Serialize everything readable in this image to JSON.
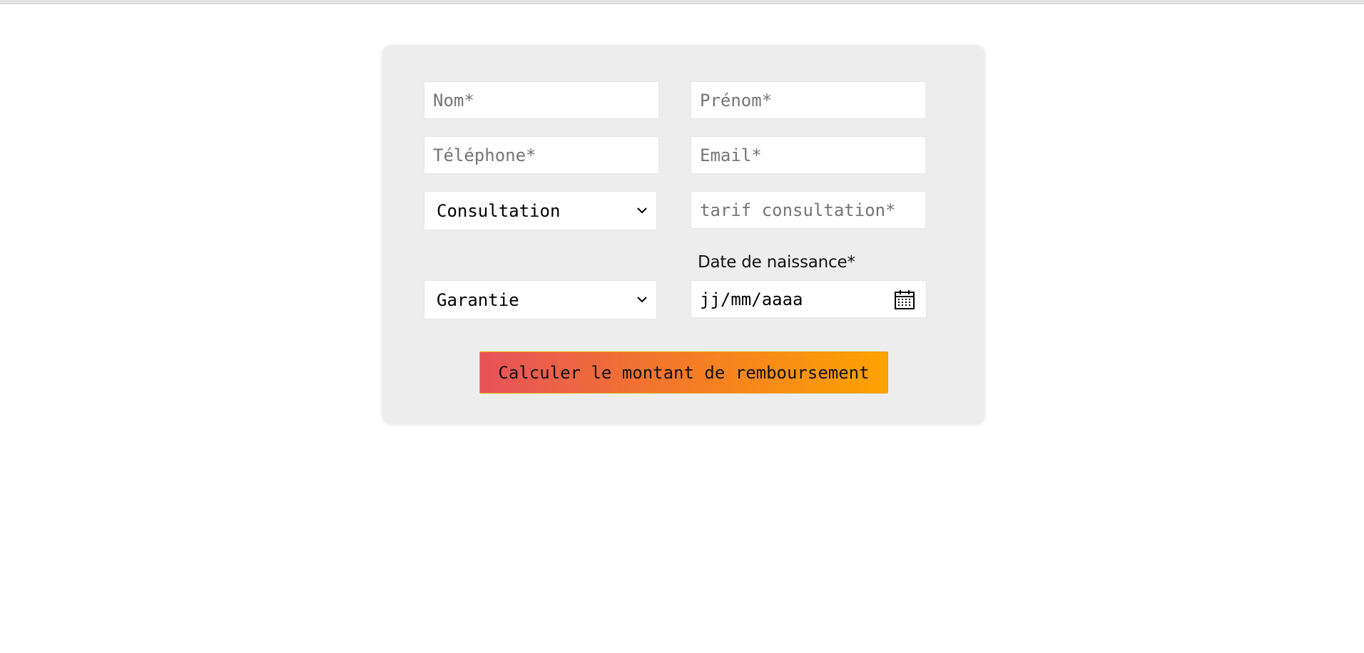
{
  "form": {
    "nom_placeholder": "Nom*",
    "prenom_placeholder": "Prénom*",
    "telephone_placeholder": "Téléphone*",
    "email_placeholder": "Email*",
    "consultation_select": "Consultation",
    "tarif_placeholder": "tarif consultation*",
    "date_label": "Date de naissance*",
    "garantie_select": "Garantie",
    "date_placeholder": "jj/mm/aaaa",
    "submit_label": "Calculer le montant de remboursement"
  },
  "colors": {
    "card_background": "#ededed",
    "button_gradient_start": "#e6525a",
    "button_gradient_end": "#fda300"
  },
  "icons": {
    "select_arrow": "chevron-down-icon",
    "date_picker": "calendar-icon"
  }
}
